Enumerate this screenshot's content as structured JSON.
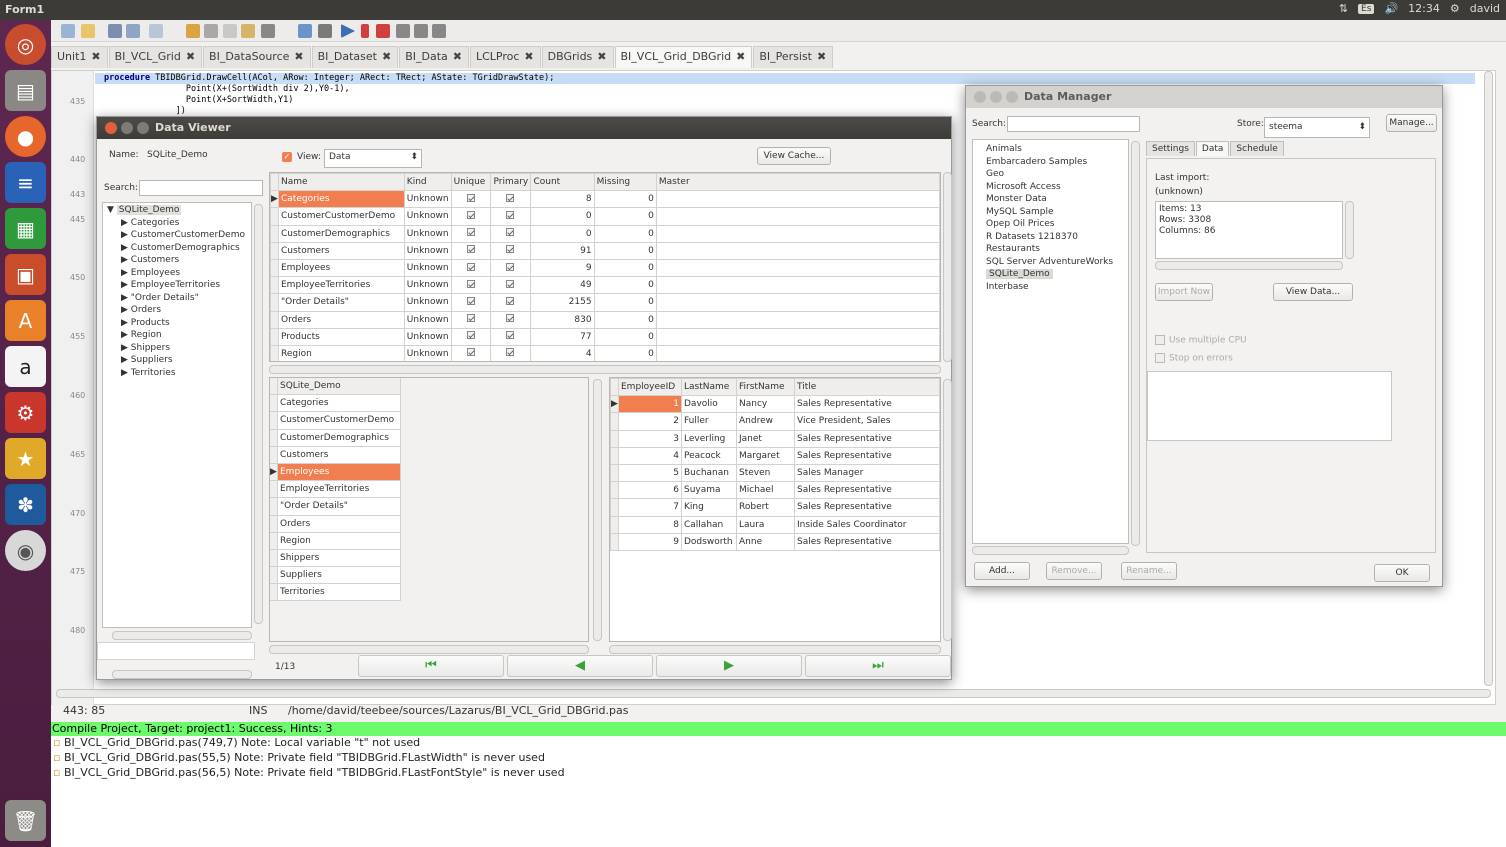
{
  "os": {
    "window_title": "Form1",
    "keyboard": "Es",
    "time": "12:34",
    "user": "david"
  },
  "editor": {
    "tabs": [
      {
        "label": "Unit1",
        "active": false
      },
      {
        "label": "BI_VCL_Grid",
        "active": false
      },
      {
        "label": "BI_DataSource",
        "active": false
      },
      {
        "label": "BI_Dataset",
        "active": false
      },
      {
        "label": "BI_Data",
        "active": false
      },
      {
        "label": "LCLProc",
        "active": false
      },
      {
        "label": "DBGrids",
        "active": false
      },
      {
        "label": "BI_VCL_Grid_DBGrid",
        "active": true
      },
      {
        "label": "BI_Persist",
        "active": false
      }
    ],
    "code_lines": [
      {
        "kw": "procedure",
        "text": " TBIDBGrid.DrawCell(ACol, ARow: Integer; ARect: TRect; AState: TGridDrawState);"
      },
      {
        "kw": "",
        "text": "                Point(X+(SortWidth div 2),Y0-1),"
      },
      {
        "kw": "",
        "text": "                Point(X+SortWidth,Y1)"
      },
      {
        "kw": "",
        "text": "              ])"
      }
    ],
    "line_numbers": [
      "435",
      "440",
      "443",
      "445",
      "450",
      "455",
      "460",
      "465",
      "470",
      "475",
      "480"
    ],
    "status": {
      "position": "443: 85",
      "mode": "INS",
      "path": "/home/david/teebee/sources/Lazarus/BI_VCL_Grid_DBGrid.pas"
    }
  },
  "messages": {
    "success": "Compile Project, Target: project1: Success, Hints: 3",
    "items": [
      "BI_VCL_Grid_DBGrid.pas(749,7) Note: Local variable \"t\" not used",
      "BI_VCL_Grid_DBGrid.pas(55,5) Note: Private field \"TBIDBGrid.FLastWidth\" is never used",
      "BI_VCL_Grid_DBGrid.pas(56,5) Note: Private field \"TBIDBGrid.FLastFontStyle\" is never used"
    ]
  },
  "data_viewer": {
    "title": "Data Viewer",
    "name_label": "Name:",
    "name_value": "SQLite_Demo",
    "view_label": "View:",
    "view_value": "Data",
    "view_cache_button": "View Cache...",
    "search_label": "Search:",
    "tree_root": "SQLite_Demo",
    "tree_items": [
      "Categories",
      "CustomerCustomerDemo",
      "CustomerDemographics",
      "Customers",
      "Employees",
      "EmployeeTerritories",
      "\"Order Details\"",
      "Orders",
      "Products",
      "Region",
      "Shippers",
      "Suppliers",
      "Territories"
    ],
    "tables_grid": {
      "headers": [
        "Name",
        "Kind",
        "Unique",
        "Primary",
        "Count",
        "Missing",
        "Master"
      ],
      "rows": [
        {
          "name": "Categories",
          "kind": "Unknown",
          "count": "8",
          "missing": "0"
        },
        {
          "name": "CustomerCustomerDemo",
          "kind": "Unknown",
          "count": "0",
          "missing": "0"
        },
        {
          "name": "CustomerDemographics",
          "kind": "Unknown",
          "count": "0",
          "missing": "0"
        },
        {
          "name": "Customers",
          "kind": "Unknown",
          "count": "91",
          "missing": "0"
        },
        {
          "name": "Employees",
          "kind": "Unknown",
          "count": "9",
          "missing": "0"
        },
        {
          "name": "EmployeeTerritories",
          "kind": "Unknown",
          "count": "49",
          "missing": "0"
        },
        {
          "name": "\"Order Details\"",
          "kind": "Unknown",
          "count": "2155",
          "missing": "0"
        },
        {
          "name": "Orders",
          "kind": "Unknown",
          "count": "830",
          "missing": "0"
        },
        {
          "name": "Products",
          "kind": "Unknown",
          "count": "77",
          "missing": "0"
        },
        {
          "name": "Region",
          "kind": "Unknown",
          "count": "4",
          "missing": "0"
        }
      ]
    },
    "list_grid": {
      "header": "SQLite_Demo",
      "items": [
        "Categories",
        "CustomerCustomerDemo",
        "CustomerDemographics",
        "Customers",
        "Employees",
        "EmployeeTerritories",
        "\"Order Details\"",
        "Orders",
        "Region",
        "Shippers",
        "Suppliers",
        "Territories"
      ],
      "selected": "Employees"
    },
    "employees_grid": {
      "headers": [
        "EmployeeID",
        "LastName",
        "FirstName",
        "Title"
      ],
      "rows": [
        [
          "1",
          "Davolio",
          "Nancy",
          "Sales Representative"
        ],
        [
          "2",
          "Fuller",
          "Andrew",
          "Vice President, Sales"
        ],
        [
          "3",
          "Leverling",
          "Janet",
          "Sales Representative"
        ],
        [
          "4",
          "Peacock",
          "Margaret",
          "Sales Representative"
        ],
        [
          "5",
          "Buchanan",
          "Steven",
          "Sales Manager"
        ],
        [
          "6",
          "Suyama",
          "Michael",
          "Sales Representative"
        ],
        [
          "7",
          "King",
          "Robert",
          "Sales Representative"
        ],
        [
          "8",
          "Callahan",
          "Laura",
          "Inside Sales Coordinator"
        ],
        [
          "9",
          "Dodsworth",
          "Anne",
          "Sales Representative"
        ]
      ]
    },
    "record_position": "1/13"
  },
  "data_manager": {
    "title": "Data Manager",
    "search_label": "Search:",
    "store_label": "Store:",
    "store_value": "steema",
    "manage_button": "Manage...",
    "stores": [
      "Animals",
      "Embarcadero Samples",
      "Geo",
      "Microsoft Access",
      "Monster Data",
      "MySQL Sample",
      "Opep Oil Prices",
      "R Datasets 1218370",
      "Restaurants",
      "SQL Server AdventureWorks",
      "SQLite_Demo",
      "Interbase"
    ],
    "selected_store": "SQLite_Demo",
    "tabs": [
      "Settings",
      "Data",
      "Schedule"
    ],
    "active_tab": "Data",
    "last_import_label": "Last import:",
    "last_import_value": "(unknown)",
    "stats": [
      "Items: 13",
      "Rows: 3308",
      "Columns: 86"
    ],
    "import_now_button": "Import Now",
    "view_data_button": "View Data...",
    "use_multiple_cpu": "Use multiple CPU",
    "stop_on_errors": "Stop on errors",
    "add_button": "Add...",
    "remove_button": "Remove...",
    "rename_button": "Rename...",
    "ok_button": "OK"
  }
}
